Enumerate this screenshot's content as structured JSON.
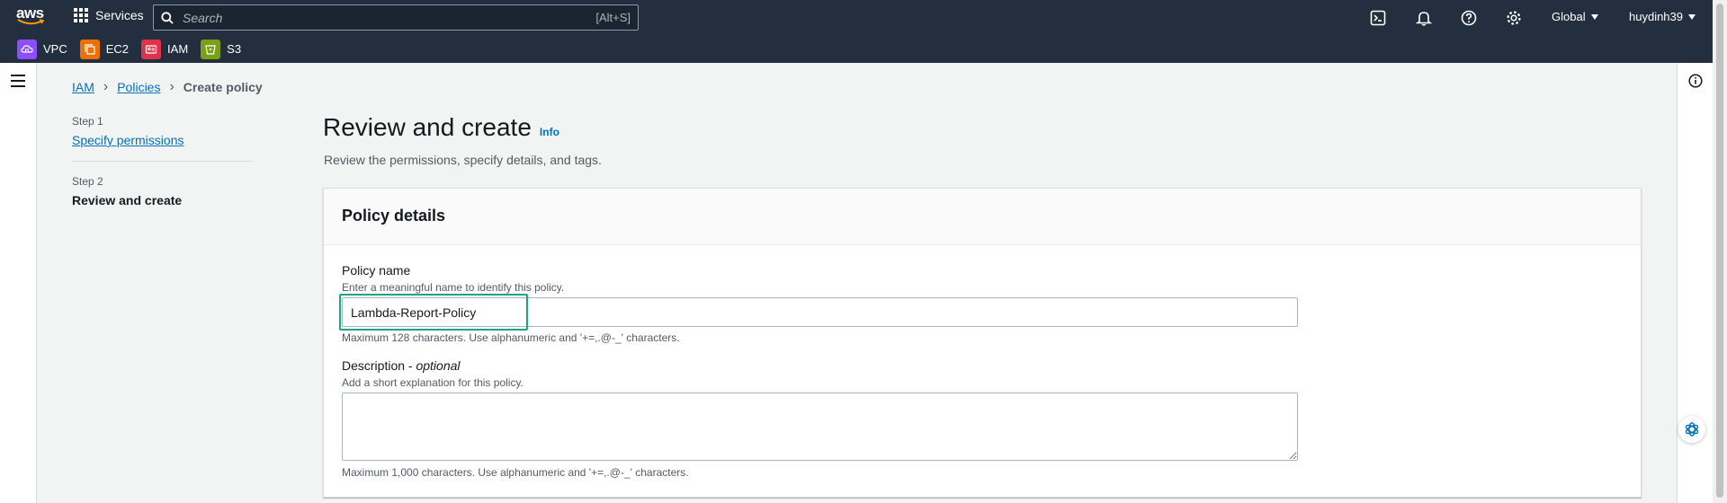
{
  "topnav": {
    "logo_text": "aws",
    "services_label": "Services",
    "search_placeholder": "Search",
    "search_shortcut": "[Alt+S]",
    "region": "Global",
    "user": "huydinh39",
    "icons": [
      "cloudshell-icon",
      "bell-icon",
      "help-icon",
      "settings-icon"
    ]
  },
  "favorites": [
    {
      "label": "VPC",
      "color": "#8c4fff"
    },
    {
      "label": "EC2",
      "color": "#ed7100"
    },
    {
      "label": "IAM",
      "color": "#dd344c"
    },
    {
      "label": "S3",
      "color": "#7aa116"
    }
  ],
  "breadcrumb": {
    "items": [
      "IAM",
      "Policies"
    ],
    "current": "Create policy"
  },
  "steps": {
    "step1_label": "Step 1",
    "step1_link": "Specify permissions",
    "step2_label": "Step 2",
    "step2_current": "Review and create"
  },
  "page": {
    "title": "Review and create",
    "info_link": "Info",
    "subtitle": "Review the permissions, specify details, and tags."
  },
  "policy_details": {
    "heading": "Policy details",
    "name_label": "Policy name",
    "name_description": "Enter a meaningful name to identify this policy.",
    "name_value": "Lambda-Report-Policy",
    "name_constraint": "Maximum 128 characters. Use alphanumeric and '+=,.@-_' characters.",
    "description_label": "Description - ",
    "description_optional": "optional",
    "description_hint": "Add a short explanation for this policy.",
    "description_value": "",
    "description_constraint": "Maximum 1,000 characters. Use alphanumeric and '+=,.@-_' characters."
  },
  "colors": {
    "nav_bg": "#232f3e",
    "link": "#0073bb",
    "highlight": "#1ea589"
  }
}
